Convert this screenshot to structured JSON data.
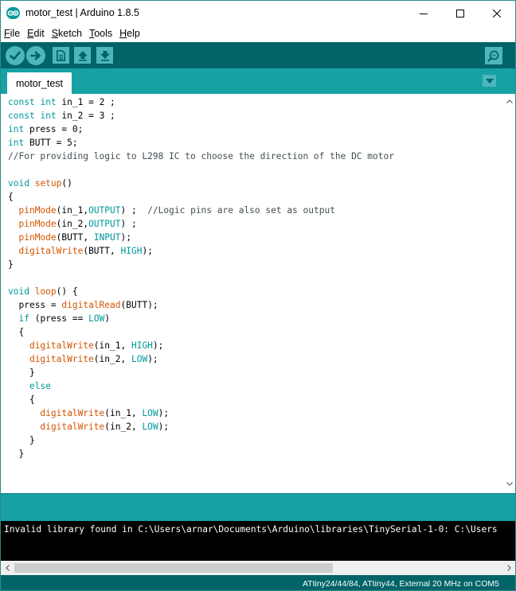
{
  "window": {
    "title": "motor_test | Arduino 1.8.5"
  },
  "menu": {
    "items": [
      {
        "label": "File",
        "accel": "F",
        "rest": "ile"
      },
      {
        "label": "Edit",
        "accel": "E",
        "rest": "dit"
      },
      {
        "label": "Sketch",
        "accel": "S",
        "rest": "ketch"
      },
      {
        "label": "Tools",
        "accel": "T",
        "rest": "ools"
      },
      {
        "label": "Help",
        "accel": "H",
        "rest": "elp"
      }
    ]
  },
  "toolbar": {
    "buttons": [
      "checkmark-icon",
      "arrow-right-icon",
      "new-file-icon",
      "open-arrow-up-icon",
      "save-arrow-down-icon",
      "magnifier-icon"
    ]
  },
  "tabs": {
    "active": "motor_test"
  },
  "code_lines": [
    "const int in_1 = 2 ;",
    "const int in_2 = 3 ;",
    "int press = 0;",
    "int BUTT = 5;",
    "//For providing logic to L298 IC to choose the direction of the DC motor",
    "",
    "void setup()",
    "{",
    "  pinMode(in_1,OUTPUT) ;  //Logic pins are also set as output",
    "  pinMode(in_2,OUTPUT) ;",
    "  pinMode(BUTT, INPUT);",
    "  digitalWrite(BUTT, HIGH);",
    "}",
    "",
    "void loop() {",
    "  press = digitalRead(BUTT);",
    "  if (press == LOW)",
    "  {",
    "    digitalWrite(in_1, HIGH);",
    "    digitalWrite(in_2, LOW);",
    "    }",
    "    else",
    "    {",
    "      digitalWrite(in_1, LOW);",
    "      digitalWrite(in_2, LOW);",
    "    }",
    "  }"
  ],
  "syntax": {
    "keywords": [
      "const",
      "int",
      "void",
      "if",
      "else",
      "OUTPUT",
      "INPUT",
      "HIGH",
      "LOW"
    ],
    "functions": [
      "setup",
      "loop",
      "pinMode",
      "digitalWrite",
      "digitalRead"
    ]
  },
  "console": {
    "message": "Invalid library found in C:\\Users\\arnar\\Documents\\Arduino\\libraries\\TinySerial-1-0: C:\\Users"
  },
  "status": {
    "board": "ATtiny24/44/84, ATtiny44, External 20 MHz on COM5"
  },
  "colors": {
    "toolbar": "#006468",
    "tabstrip": "#17a1a5",
    "button": "#4db7bb",
    "keyword": "#00979c",
    "function": "#d35400",
    "comment": "#434f54"
  }
}
